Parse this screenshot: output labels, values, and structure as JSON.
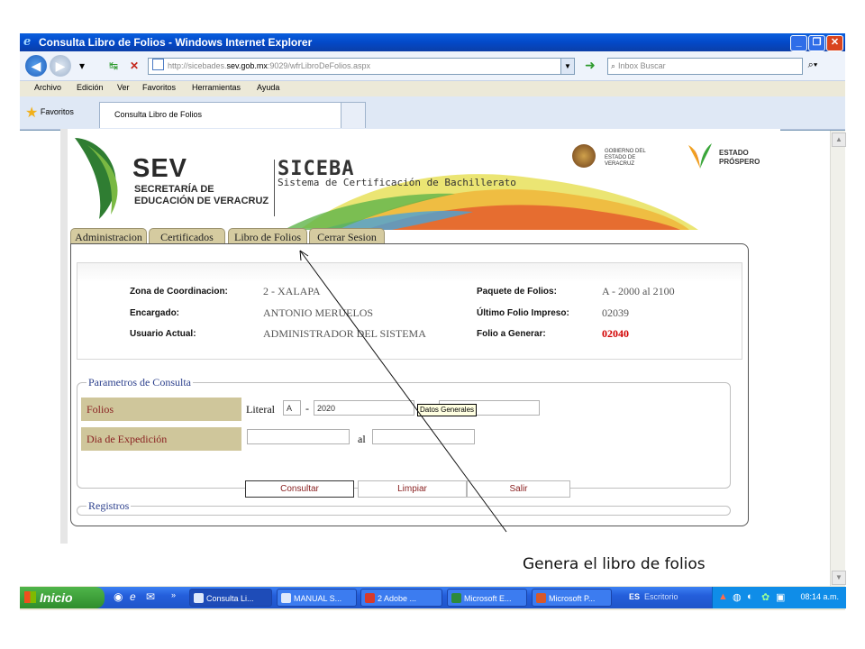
{
  "window": {
    "title": "Consulta Libro de Folios - Windows Internet Explorer"
  },
  "address_bar": {
    "url_prefix": "http://sicebades.",
    "url_host": "sev.gob.mx",
    "url_suffix": ":9029/wfrLibroDeFolios.aspx",
    "search_placeholder": "Inbox Buscar"
  },
  "menu": [
    "Archivo",
    "Edición",
    "Ver",
    "Favoritos",
    "Herramientas",
    "Ayuda"
  ],
  "favorites": {
    "label": "Favoritos",
    "tab_title": "Consulta Libro de Folios"
  },
  "header": {
    "sev": "SEV",
    "sev_sub": "SECRETARÍA DE EDUCACIÓN DE VERACRUZ",
    "siceba": "SICEBA",
    "siceba_sub": "Sistema de Certificación de Bachillerato",
    "gob": "GOBIERNO DEL ESTADO DE VERACRUZ",
    "estado": "ESTADO PRÓSPERO"
  },
  "tabs": [
    "Administracion",
    "Certificados",
    "Libro de Folios",
    "Cerrar Sesion"
  ],
  "info": {
    "zona_label": "Zona de Coordinacion:",
    "zona_value": "2 - XALAPA",
    "encargado_label": "Encargado:",
    "encargado_value": "ANTONIO MERUELOS",
    "usuario_label": "Usuario Actual:",
    "usuario_value": "ADMINISTRADOR DEL SISTEMA",
    "paquete_label": "Paquete de Folios:",
    "paquete_value": "A - 2000 al 2100",
    "ultimo_label": "Último Folio Impreso:",
    "ultimo_value": "02039",
    "generar_label": "Folio a Generar:",
    "generar_value": "02040"
  },
  "params": {
    "legend": "Parametros de Consulta",
    "folios_label": "Folios",
    "literal_label": "Literal",
    "literal_value": "A",
    "dash": "-",
    "folio_from": "2020",
    "tooltip": "Datos Generales",
    "fecha_label": "Dia de Expedición",
    "al_label": "al",
    "btn_consultar": "Consultar",
    "btn_limpiar": "Limpiar",
    "btn_salir": "Salir"
  },
  "registros": {
    "legend": "Registros"
  },
  "taskbar": {
    "start": "Inicio",
    "tasks": [
      "Consulta Li...",
      "MANUAL S...",
      "2 Adobe ...",
      "Microsoft E...",
      "Microsoft P..."
    ],
    "lang": "ES",
    "escritorio": "Escritorio",
    "clock": "08:14 a.m."
  },
  "caption": "Genera el libro de folios"
}
